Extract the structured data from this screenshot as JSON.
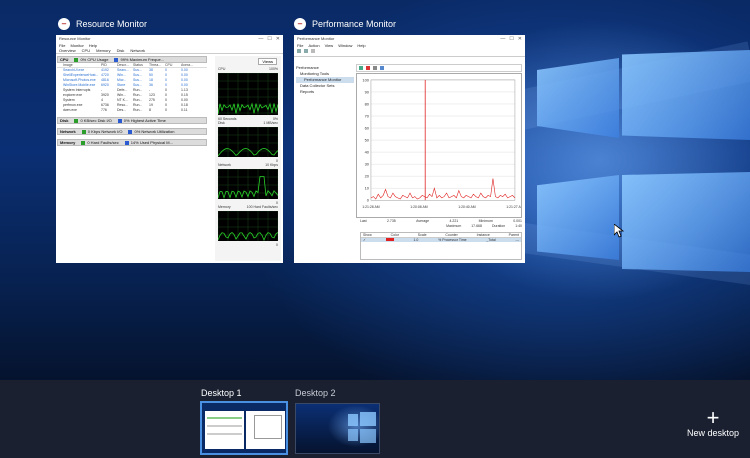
{
  "windows": [
    {
      "title": "Resource Monitor",
      "app_icon": "resmon-icon",
      "content": {
        "titlebar": "Resource Monitor",
        "menu": [
          "File",
          "Monitor",
          "Help"
        ],
        "tabs": [
          "Overview",
          "CPU",
          "Memory",
          "Disk",
          "Network"
        ],
        "sections": [
          {
            "name": "CPU",
            "meter1": "0% CPU Usage",
            "meter2": "99% Maximum Freque..."
          },
          {
            "name": "Disk",
            "meter1": "0 KB/sec Disk I/O",
            "meter2": "0% Highest Active Time"
          },
          {
            "name": "Network",
            "meter1": "0 Kbps Network I/O",
            "meter2": "0% Network Utilization"
          },
          {
            "name": "Memory",
            "meter1": "0 Hard Faults/sec",
            "meter2": "14% Used Physical M..."
          }
        ],
        "columns": [
          "Image",
          "PID",
          "Descr...",
          "Status",
          "Threa...",
          "CPU",
          "Avera..."
        ],
        "rows": [
          [
            "SearchUI.exe",
            "4192",
            "Searc...",
            "Sus...",
            "38",
            "0",
            "0.00"
          ],
          [
            "ShellExperienceHost...",
            "4720",
            "Win...",
            "Sus...",
            "50",
            "0",
            "0.00"
          ],
          [
            "Microsoft.Photos.exe",
            "4816",
            "Micr...",
            "Sus...",
            "18",
            "0",
            "0.00"
          ],
          [
            "WinStore.Mobile.exe",
            "6920",
            "Store",
            "Sus...",
            "36",
            "0",
            "0.00"
          ],
          [
            "System Interrupts",
            "-",
            "Defe...",
            "Run...",
            "-",
            "0",
            "1.13"
          ],
          [
            "explorer.exe",
            "3920",
            "Win...",
            "Run...",
            "123",
            "0",
            "0.15"
          ],
          [
            "System",
            "4",
            "NT K...",
            "Run...",
            "275",
            "0",
            "0.00"
          ],
          [
            "perfmon.exe",
            "6736",
            "Reso...",
            "Run...",
            "19",
            "0",
            "0.18"
          ],
          [
            "dwm.exe",
            "776",
            "Des...",
            "Run...",
            "8",
            "0",
            "0.11"
          ]
        ],
        "views_label": "Views",
        "graphs": [
          {
            "label": "CPU",
            "right": "100%",
            "bottom_left": "60 Seconds",
            "bottom_right": "0%"
          },
          {
            "label": "Disk",
            "right": "1 MB/sec",
            "bottom_left": "",
            "bottom_right": "0"
          },
          {
            "label": "Network",
            "right": "10 Kbps",
            "bottom_left": "",
            "bottom_right": "0"
          },
          {
            "label": "Memory",
            "right": "100 Hard Faults/sec",
            "bottom_left": "",
            "bottom_right": "0"
          }
        ]
      }
    },
    {
      "title": "Performance Monitor",
      "app_icon": "perfmon-icon",
      "content": {
        "titlebar": "Performance Monitor",
        "menu": [
          "File",
          "Action",
          "View",
          "Window",
          "Help"
        ],
        "tree": [
          "Performance",
          "Monitoring Tools",
          "Performance Monitor",
          "Data Collector Sets",
          "Reports"
        ],
        "y_ticks": [
          "100",
          "90",
          "80",
          "70",
          "60",
          "50",
          "40",
          "30",
          "20",
          "10",
          "0"
        ],
        "x_ticks": [
          "1:21:28 AM",
          "1:20:08 AM",
          "1:20:40 AM",
          "1:21:27 AM"
        ],
        "stats": {
          "last_label": "Last",
          "last": "2.735",
          "average_label": "Average",
          "average": "4.221",
          "minimum_label": "Minimum",
          "minimum": "0.001",
          "maximum_label": "Maximum",
          "maximum": "17.668",
          "duration_label": "Duration",
          "duration": "1:40"
        },
        "grid_headers": [
          "Show",
          "Color",
          "Scale",
          "Counter",
          "Instance",
          "Parent"
        ],
        "grid_row": [
          "✓",
          "",
          "1.0",
          "% Processor Time",
          "_Total",
          "---"
        ]
      }
    }
  ],
  "desktops": [
    {
      "label": "Desktop 1",
      "active": true
    },
    {
      "label": "Desktop 2",
      "active": false
    }
  ],
  "new_desktop_label": "New desktop",
  "colors": {
    "active_desktop_border": "#4a90e2",
    "strip_bg": "#1a2030",
    "perf_line": "#e02020"
  },
  "perf_series": [
    2,
    3,
    1,
    5,
    2,
    4,
    9,
    3,
    2,
    6,
    3,
    2,
    1,
    4,
    3,
    2,
    6,
    2,
    3,
    1,
    2,
    4,
    3,
    2,
    5,
    3,
    10,
    2,
    4,
    2,
    3,
    6,
    2,
    3,
    4,
    2,
    8,
    3,
    2,
    4,
    3,
    2,
    5,
    3,
    2,
    6,
    3,
    2,
    4,
    3,
    18,
    3,
    2,
    4,
    3,
    5,
    2,
    3,
    4,
    2
  ]
}
